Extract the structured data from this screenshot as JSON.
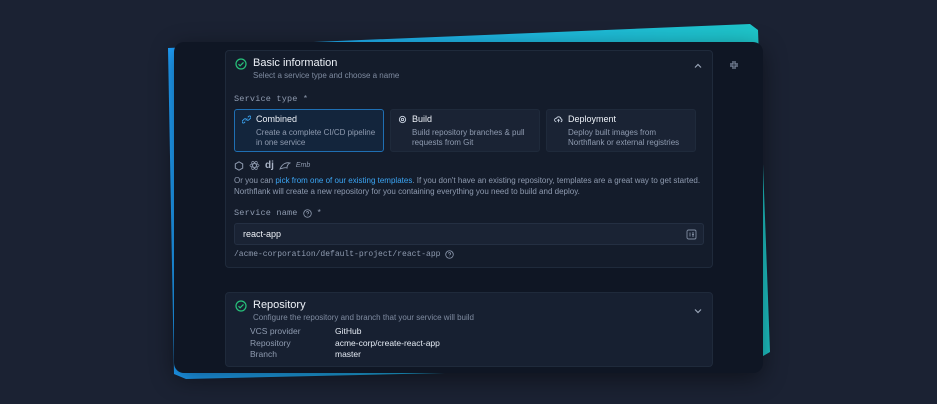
{
  "basic": {
    "title": "Basic information",
    "subtitle": "Select a service type and choose a name",
    "service_type_label": "Service type *",
    "types": [
      {
        "label": "Combined",
        "desc": "Create a complete CI/CD pipeline in one service"
      },
      {
        "label": "Build",
        "desc": "Build repository branches & pull requests from Git"
      },
      {
        "label": "Deployment",
        "desc": "Deploy built images from Northflank or external registries"
      }
    ],
    "framework_django": "dj",
    "framework_other": "Emb",
    "templates_prefix": "Or you can ",
    "templates_link": "pick from one of our existing templates",
    "templates_suffix": ". If you don't have an existing repository, templates are a great way to get started. Northflank will create a new repository for you containing everything you need to build and deploy.",
    "service_name_label": "Service name",
    "service_name_required": "*",
    "service_name_value": "react-app",
    "service_path": "/acme-corporation/default-project/react-app"
  },
  "repo": {
    "title": "Repository",
    "subtitle": "Configure the repository and branch that your service will build",
    "rows": [
      {
        "k": "VCS provider",
        "v": "GitHub"
      },
      {
        "k": "Repository",
        "v": "acme-corp/create-react-app"
      },
      {
        "k": "Branch",
        "v": "master"
      }
    ]
  },
  "colors": {
    "accent": "#1fa2ff",
    "teal": "#1ec6c8",
    "success": "#27c27b"
  }
}
